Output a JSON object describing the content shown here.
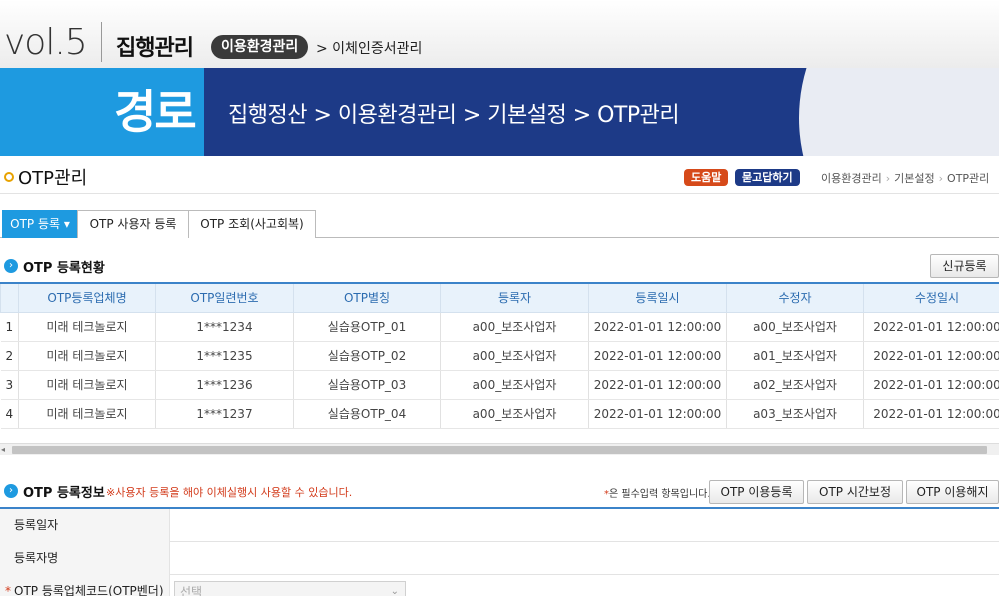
{
  "header": {
    "vol": "vol.5",
    "section": "집행관리",
    "env_badge": "이용환경관리",
    "crumb": "> 이체인증서관리"
  },
  "banner": {
    "label": "경로",
    "path": "집행정산 > 이용환경관리 > 기본설정 > OTP관리"
  },
  "page": {
    "title": "OTP관리",
    "help": "도움말",
    "qa": "묻고답하기",
    "crumbs": [
      "이용환경관리",
      "기본설정",
      "OTP관리"
    ]
  },
  "tabs": [
    {
      "label": "OTP 등록 ▾",
      "active": true
    },
    {
      "label": "OTP 사용자 등록",
      "active": false
    },
    {
      "label": "OTP 조회(사고회복)",
      "active": false
    }
  ],
  "status_section": {
    "title": "OTP 등록현황",
    "new_button": "신규등록"
  },
  "table": {
    "columns": [
      "",
      "OTP등록업체명",
      "OTP일련번호",
      "OTP별칭",
      "등록자",
      "등록일시",
      "수정자",
      "수정일시"
    ],
    "rows": [
      [
        "1",
        "미래 테크놀로지",
        "1***1234",
        "실습용OTP_01",
        "a00_보조사업자",
        "2022-01-01 12:00:00",
        "a00_보조사업자",
        "2022-01-01 12:00:00"
      ],
      [
        "2",
        "미래 테크놀로지",
        "1***1235",
        "실습용OTP_02",
        "a00_보조사업자",
        "2022-01-01 12:00:00",
        "a01_보조사업자",
        "2022-01-01 12:00:00"
      ],
      [
        "3",
        "미래 테크놀로지",
        "1***1236",
        "실습용OTP_03",
        "a00_보조사업자",
        "2022-01-01 12:00:00",
        "a02_보조사업자",
        "2022-01-01 12:00:00"
      ],
      [
        "4",
        "미래 테크놀로지",
        "1***1237",
        "실습용OTP_04",
        "a00_보조사업자",
        "2022-01-01 12:00:00",
        "a03_보조사업자",
        "2022-01-01 12:00:00"
      ]
    ]
  },
  "info_section": {
    "title": "OTP 등록정보",
    "note": "※사용자 등록을 해야 이체실행시 사용할 수 있습니다.",
    "required_star": "*",
    "required_note": "은 필수입력 항목입니다.",
    "buttons": [
      "OTP 이용등록",
      "OTP 시간보정",
      "OTP 이용해지"
    ]
  },
  "form": {
    "reg_date_label": "등록일자",
    "reg_name_label": "등록자명",
    "vendor_label": "OTP 등록업체코드(OTP벤더)",
    "vendor_star": "*",
    "vendor_placeholder": "선택"
  },
  "colors": {
    "banner_dark": "#1d3a87",
    "banner_light": "#1e9ae0",
    "accent_red": "#d23a1a"
  }
}
